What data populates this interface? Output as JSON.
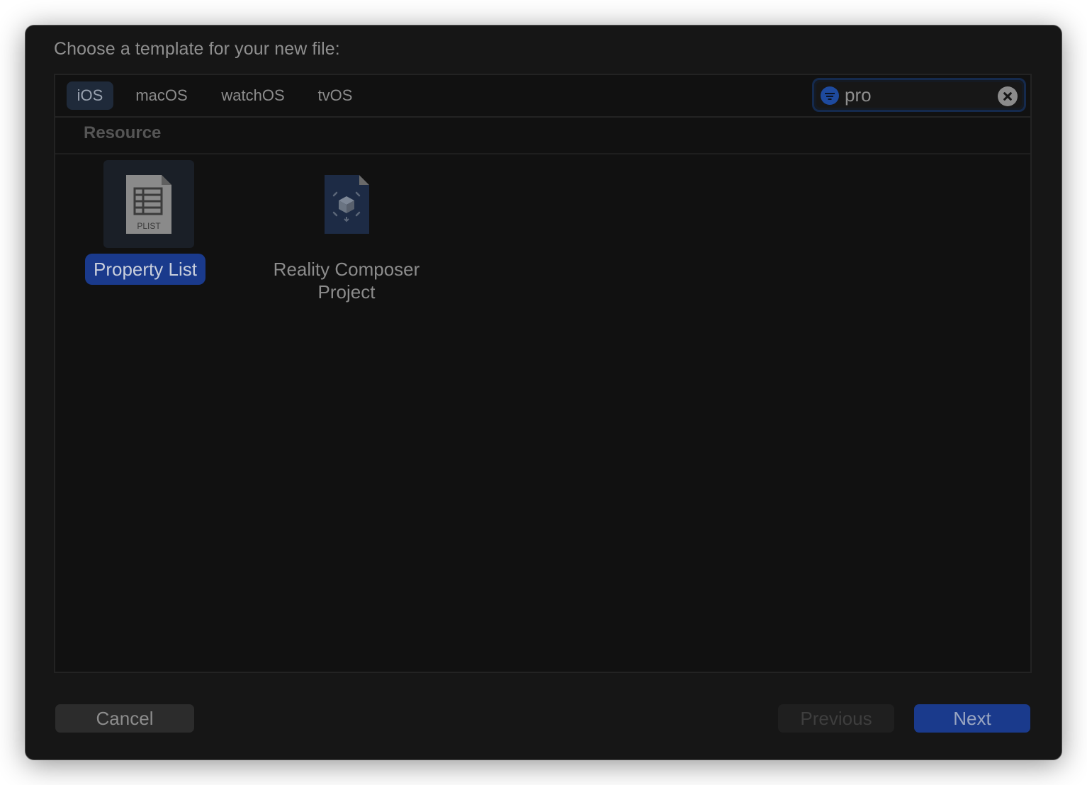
{
  "dialog": {
    "title": "Choose a template for your new file:"
  },
  "tabs": [
    {
      "label": "iOS",
      "selected": true
    },
    {
      "label": "macOS",
      "selected": false
    },
    {
      "label": "watchOS",
      "selected": false
    },
    {
      "label": "tvOS",
      "selected": false
    }
  ],
  "search": {
    "value": "pro",
    "filter_icon": "filter-icon",
    "clear_icon": "clear-icon"
  },
  "section": {
    "label": "Resource"
  },
  "templates": [
    {
      "label": "Property List",
      "icon": "plist-file-icon",
      "icon_caption": "PLIST",
      "selected": true
    },
    {
      "label": "Reality Composer Project",
      "label_line1": "Reality Composer",
      "label_line2": "Project",
      "icon": "reality-composer-file-icon",
      "selected": false
    }
  ],
  "buttons": {
    "cancel": "Cancel",
    "previous": "Previous",
    "next": "Next"
  },
  "colors": {
    "accent": "#1a3a8c",
    "sheet_background": "#161616",
    "panel_background": "#111111"
  }
}
